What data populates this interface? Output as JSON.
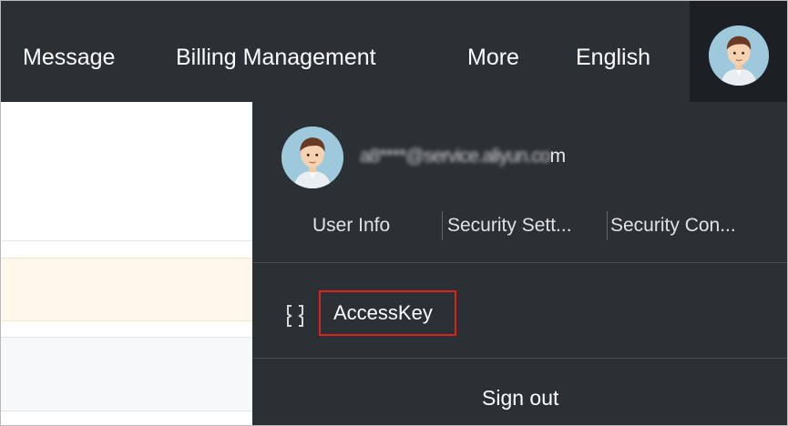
{
  "nav": {
    "items": [
      {
        "label": "Message"
      },
      {
        "label": "Billing Management"
      },
      {
        "label": "More"
      },
      {
        "label": "English"
      }
    ]
  },
  "account_menu": {
    "email_masked_prefix": "a8****@service.aliyun.co",
    "email_suffix": "m",
    "links": [
      {
        "label": "User Info"
      },
      {
        "label": "Security Sett..."
      },
      {
        "label": "Security Con..."
      }
    ],
    "accesskey_label": "AccessKey",
    "accesskey_icon": "accesskey-icon",
    "sign_out_label": "Sign out"
  },
  "colors": {
    "topbar_bg": "#2b3035",
    "dropdown_bg": "#2b3035",
    "highlight_border": "#dd1f1f",
    "alert_row_bg": "#fff8ea",
    "row_bg": "#f6f8fa"
  }
}
